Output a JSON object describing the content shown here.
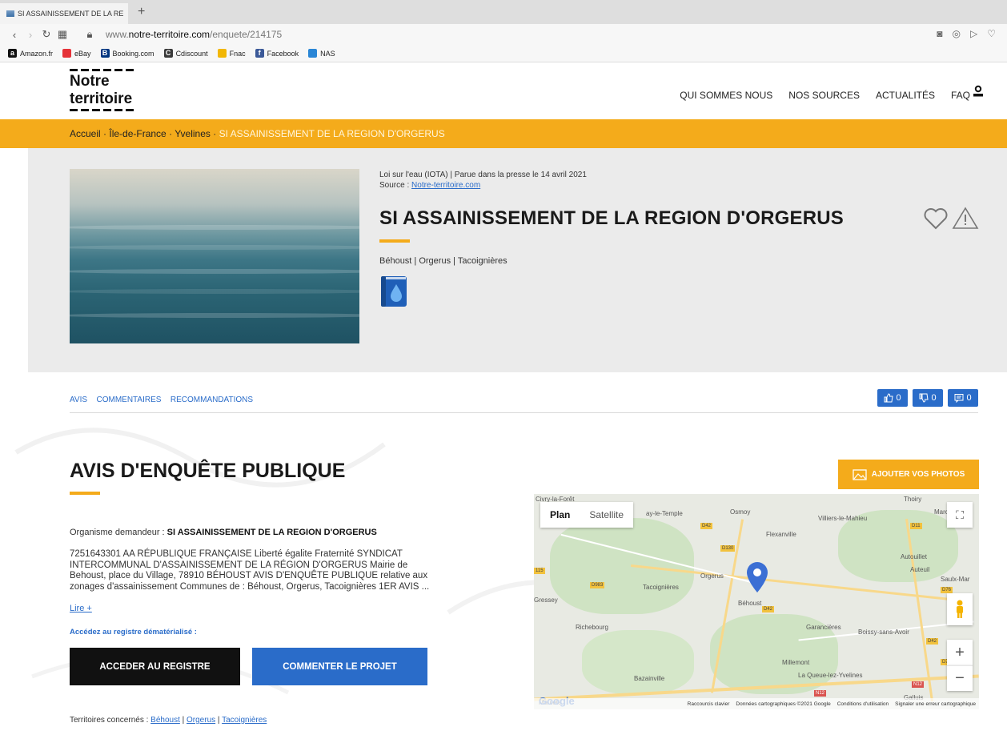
{
  "browser": {
    "tab_title": "SI ASSAINISSEMENT DE LA RE",
    "new_tab": "+",
    "url_prefix": "www.",
    "url_domain": "notre-territoire.com",
    "url_path": "/enquete/214175",
    "bookmarks": [
      {
        "label": "Amazon.fr",
        "icon": "amazon-icon",
        "color": "#111111",
        "glyph": "a"
      },
      {
        "label": "eBay",
        "icon": "ebay-icon",
        "color": "#e53238",
        "glyph": ""
      },
      {
        "label": "Booking.com",
        "icon": "booking-icon",
        "color": "#003580",
        "glyph": "B"
      },
      {
        "label": "Cdiscount",
        "icon": "cdiscount-icon",
        "color": "#3a3a3a",
        "glyph": "C"
      },
      {
        "label": "Fnac",
        "icon": "fnac-icon",
        "color": "#f2b705",
        "glyph": ""
      },
      {
        "label": "Facebook",
        "icon": "facebook-icon",
        "color": "#3b5998",
        "glyph": "f"
      },
      {
        "label": "NAS",
        "icon": "nas-icon",
        "color": "#2a86d6",
        "glyph": ""
      }
    ]
  },
  "header": {
    "logo_line1": "Notre",
    "logo_line2": "territoire",
    "nav": [
      "QUI SOMMES NOUS",
      "NOS SOURCES",
      "ACTUALITÉS",
      "FAQ"
    ]
  },
  "breadcrumb": {
    "home": "Accueil",
    "region": "Île-de-France",
    "dept": "Yvelines",
    "sep": " · ",
    "current": "SI ASSAINISSEMENT DE LA REGION D'ORGERUS"
  },
  "hero": {
    "meta_line": "Loi sur l'eau (IOTA) | Parue dans la presse le 14 avril 2021",
    "source_label": "Source : ",
    "source_link": "Notre-territoire.com",
    "title": "SI ASSAINISSEMENT DE LA REGION D'ORGERUS",
    "communes": "Béhoust | Orgerus | Tacoignières"
  },
  "tabs": [
    "AVIS",
    "COMMENTAIRES",
    "RECOMMANDATIONS"
  ],
  "counters": {
    "likes": "0",
    "dislikes": "0",
    "comments": "0"
  },
  "avis": {
    "title": "AVIS D'ENQUÊTE PUBLIQUE",
    "organisme_label": "Organisme demandeur : ",
    "organisme": "SI ASSAINISSEMENT DE LA REGION D'ORGERUS",
    "body": "7251643301 AA RÉPUBLIQUE FRANÇAISE Liberté égalite Fraternité SYNDICAT INTERCOMMUNAL D'ASSAINISSEMENT DE LA RÉGION D'ORGERUS Mairie de Behoust, place du Village, 78910 BÉHOUST AVIS D'ENQUÊTE PUBLIQUE relative aux zonages d'assainissement Communes de : Béhoust, Orgerus, Tacoignières 1ER AVIS ...",
    "read_more": "Lire +",
    "registre_label": "Accédez au registre dématérialisé :",
    "btn_registre": "ACCEDER AU REGISTRE",
    "btn_commenter": "COMMENTER LE PROJET",
    "territoires_label": "Territoires concernés : ",
    "territoires": [
      "Béhoust",
      "Orgerus",
      "Tacoignières"
    ],
    "territoires_sep": " | "
  },
  "photos_btn": "AJOUTER VOS PHOTOS",
  "map": {
    "type_plan": "Plan",
    "type_satellite": "Satellite",
    "labels": [
      "Civry-la-Forêt",
      "Osmoy",
      "Thoiry",
      "Marcq",
      "Villiers-le-Mahieu",
      "Flexanville",
      "Autouillet",
      "Auteuil",
      "Saulx-Mar",
      "Orgerus",
      "Tacoignières",
      "Béhoust",
      "Richebourg",
      "Garancières",
      "Boissy-sans-Avoir",
      "Millemont",
      "La Queue-lez-Yvelines",
      "Bazainville",
      "Gressey",
      "Galluis",
      "Mauléte",
      "ay-le-Temple"
    ],
    "roads": [
      "D42",
      "D130",
      "D983",
      "D11",
      "D76",
      "D42",
      "D42",
      "D76",
      "N12",
      "N12",
      "115"
    ],
    "footer": [
      "Raccourcis clavier",
      "Données cartographiques ©2021 Google",
      "Conditions d'utilisation",
      "Signaler une erreur cartographique"
    ],
    "google": "Google",
    "zoom_in": "+",
    "zoom_out": "−"
  }
}
